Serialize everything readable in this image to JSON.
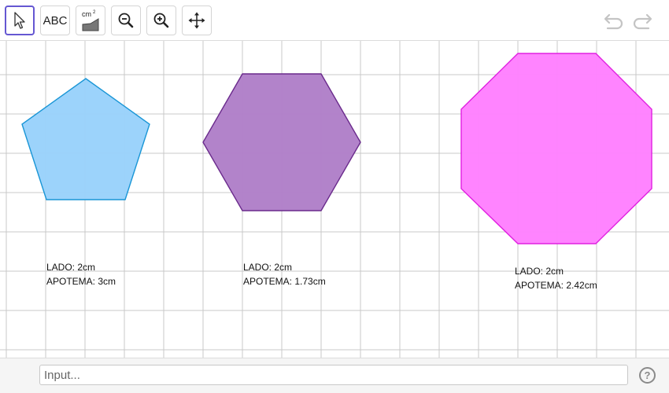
{
  "toolbar": {
    "tools": [
      {
        "name": "move-tool",
        "icon": "arrow-cursor-icon",
        "active": true
      },
      {
        "name": "text-tool",
        "label": "ABC",
        "icon": "text-icon"
      },
      {
        "name": "area-tool",
        "label": "cm",
        "superscript": "2",
        "icon": "area-icon"
      },
      {
        "name": "zoom-out-tool",
        "icon": "zoom-out-icon"
      },
      {
        "name": "zoom-in-tool",
        "icon": "zoom-in-icon"
      },
      {
        "name": "move-view-tool",
        "icon": "move-arrows-icon"
      }
    ],
    "undo_icon": "undo-icon",
    "redo_icon": "redo-icon"
  },
  "colors": {
    "accent": "#6557d2",
    "grid": "#c8c8c8",
    "pentagon_fill": "#99d2fb",
    "pentagon_stroke": "#1a96d6",
    "hexagon_fill": "#b07fc8",
    "hexagon_stroke": "#6a2a8c",
    "octagon_fill": "#ff80ff",
    "octagon_stroke": "#e020e0"
  },
  "shapes": {
    "pentagon": {
      "side_line": "LADO: 2cm",
      "apothem_line": "APOTEMA: 3cm"
    },
    "hexagon": {
      "side_line": "LADO: 2cm",
      "apothem_line": "APOTEMA: 1.73cm"
    },
    "octagon": {
      "side_line": "LADO: 2cm",
      "apothem_line": "APOTEMA: 2.42cm"
    }
  },
  "input_bar": {
    "value": "",
    "placeholder": "Input...",
    "help_label": "?"
  }
}
